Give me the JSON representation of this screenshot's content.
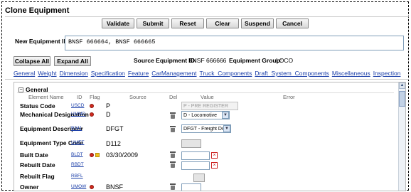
{
  "title": "Clone Equipment",
  "actions": [
    "Validate",
    "Submit",
    "Reset",
    "Clear",
    "Suspend",
    "Cancel"
  ],
  "new_equipment": {
    "label": "New Equipment ID(s):",
    "value": "BNSF 666664, BNSF 666665"
  },
  "collapse_all": "Collapse All",
  "expand_all": "Expand All",
  "source_equipment": {
    "label": "Source Equipment ID:",
    "value": "BNSF 666666"
  },
  "equipment_group": {
    "label": "Equipment Group:",
    "value": "LOCO"
  },
  "tabs": [
    "General",
    "Weight",
    "Dimension",
    "Specification",
    "Feature",
    "CarManagement",
    "Truck_Components",
    "Draft_System_Components",
    "Miscellaneous",
    "Inspection"
  ],
  "section": {
    "name": "General",
    "toggle": "−"
  },
  "columns": {
    "element_name": "Element Name",
    "id": "ID",
    "flag": "Flag",
    "source": "Source",
    "del": "Del",
    "value": "Value",
    "error": "Error"
  },
  "rows": [
    {
      "name": "Status Code",
      "id": "USCD",
      "source": "P",
      "value": "P - PRE REGISTER"
    },
    {
      "name": "Mechanical Designation",
      "id": "UMMD",
      "source": "D",
      "value": "D - Locomotive"
    },
    {
      "name": "Equipment Descriptor",
      "id": "B341",
      "source": "DFGT",
      "value": "DFGT - Freight Diesel"
    },
    {
      "name": "Equipment Type Code",
      "id": "UMET",
      "source": "D112",
      "value": ""
    },
    {
      "name": "Built Date",
      "id": "BLDT",
      "source": "03/30/2009",
      "value": ""
    },
    {
      "name": "Rebuilt Date",
      "id": "RBDT",
      "source": "",
      "value": ""
    },
    {
      "name": "Rebuilt Flag",
      "id": "RBFL",
      "source": "",
      "value": ""
    },
    {
      "name": "Owner",
      "id": "UMOW",
      "source": "BNSF",
      "value": ""
    }
  ],
  "icons": {
    "trash": "trash-icon",
    "calendar": "calendar-icon",
    "flag_red": "red-flag-dot",
    "flag_yellow": "yellow-flag-square"
  },
  "colors": {
    "link": "#1a3ea8",
    "flag_red": "#d12a1e",
    "flag_yellow": "#f2c21b"
  }
}
